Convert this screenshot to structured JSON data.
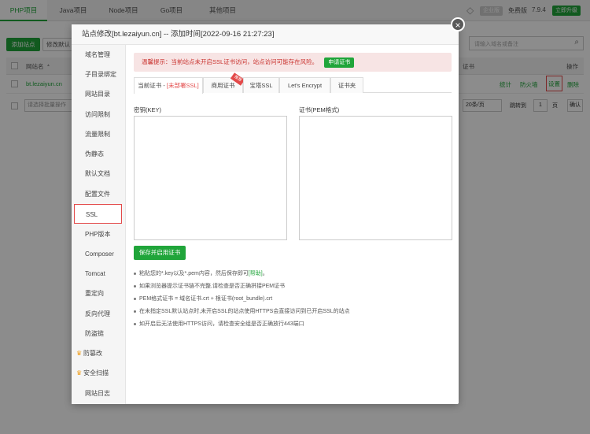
{
  "topbar": {
    "tabs": [
      "PHP项目",
      "Java项目",
      "Node项目",
      "Go项目",
      "其他项目"
    ],
    "badge": "企业版",
    "edition": "免费版",
    "version": "7.9.4",
    "upgrade": "立即升级"
  },
  "page": {
    "add_site": "添加站点",
    "edit_default": "修改默认",
    "search_placeholder": "请输入域名或备注",
    "col_site": "网站名",
    "col_ssl": "证书",
    "col_ops": "操作",
    "site_name": "bt.lezaiyun.cn",
    "op_stats": "统计",
    "op_firewall": "防火墙",
    "op_settings": "设置",
    "op_delete": "删除",
    "batch_placeholder": "请选择批量操作",
    "page_size": "20条/页",
    "goto_label": "跳转到",
    "goto_value": "1",
    "page_unit": "页",
    "confirm": "确认"
  },
  "modal": {
    "title": "站点修改[bt.lezaiyun.cn] -- 添加时间[2022-09-16 21:27:23]",
    "close": "×",
    "sidebar": [
      "域名管理",
      "子目录绑定",
      "网站目录",
      "访问限制",
      "流量限制",
      "伪静态",
      "默认文档",
      "配置文件",
      "SSL",
      "PHP版本",
      "Composer",
      "Tomcat",
      "重定向",
      "反向代理",
      "防盗链",
      "防篡改",
      "安全扫描",
      "网站日志"
    ],
    "warning": "温馨提示：当前站点未开启SSL证书访问，站点访问可能存在风险。",
    "apply_cert": "申请证书",
    "tabs": {
      "current": "当前证书 - ",
      "current_status": "[未部署SSL]",
      "commercial": "商用证书",
      "ribbon": "推荐",
      "baota": "宝塔SSL",
      "letsencrypt": "Let's Encrypt",
      "folder": "证书夹"
    },
    "key_label": "密钥(KEY)",
    "pem_label": "证书(PEM格式)",
    "save_button": "保存并启用证书",
    "tip1_a": "粘贴您的*.key以及*.pem内容，然后保存即可",
    "tip1_link": "[帮助]",
    "tip1_b": "。",
    "tip2": "如果浏览器提示证书链不完整,请检查是否正确拼接PEM证书",
    "tip3": "PEM格式证书 = 域名证书.crt + 根证书(root_bundle).crt",
    "tip4": "在未指定SSL默认站点时,未开启SSL的站点使用HTTPS会直接访问到已开启SSL的站点",
    "tip5": "如开启后无法使用HTTPS访问，请检查安全组是否正确放行443端口"
  }
}
